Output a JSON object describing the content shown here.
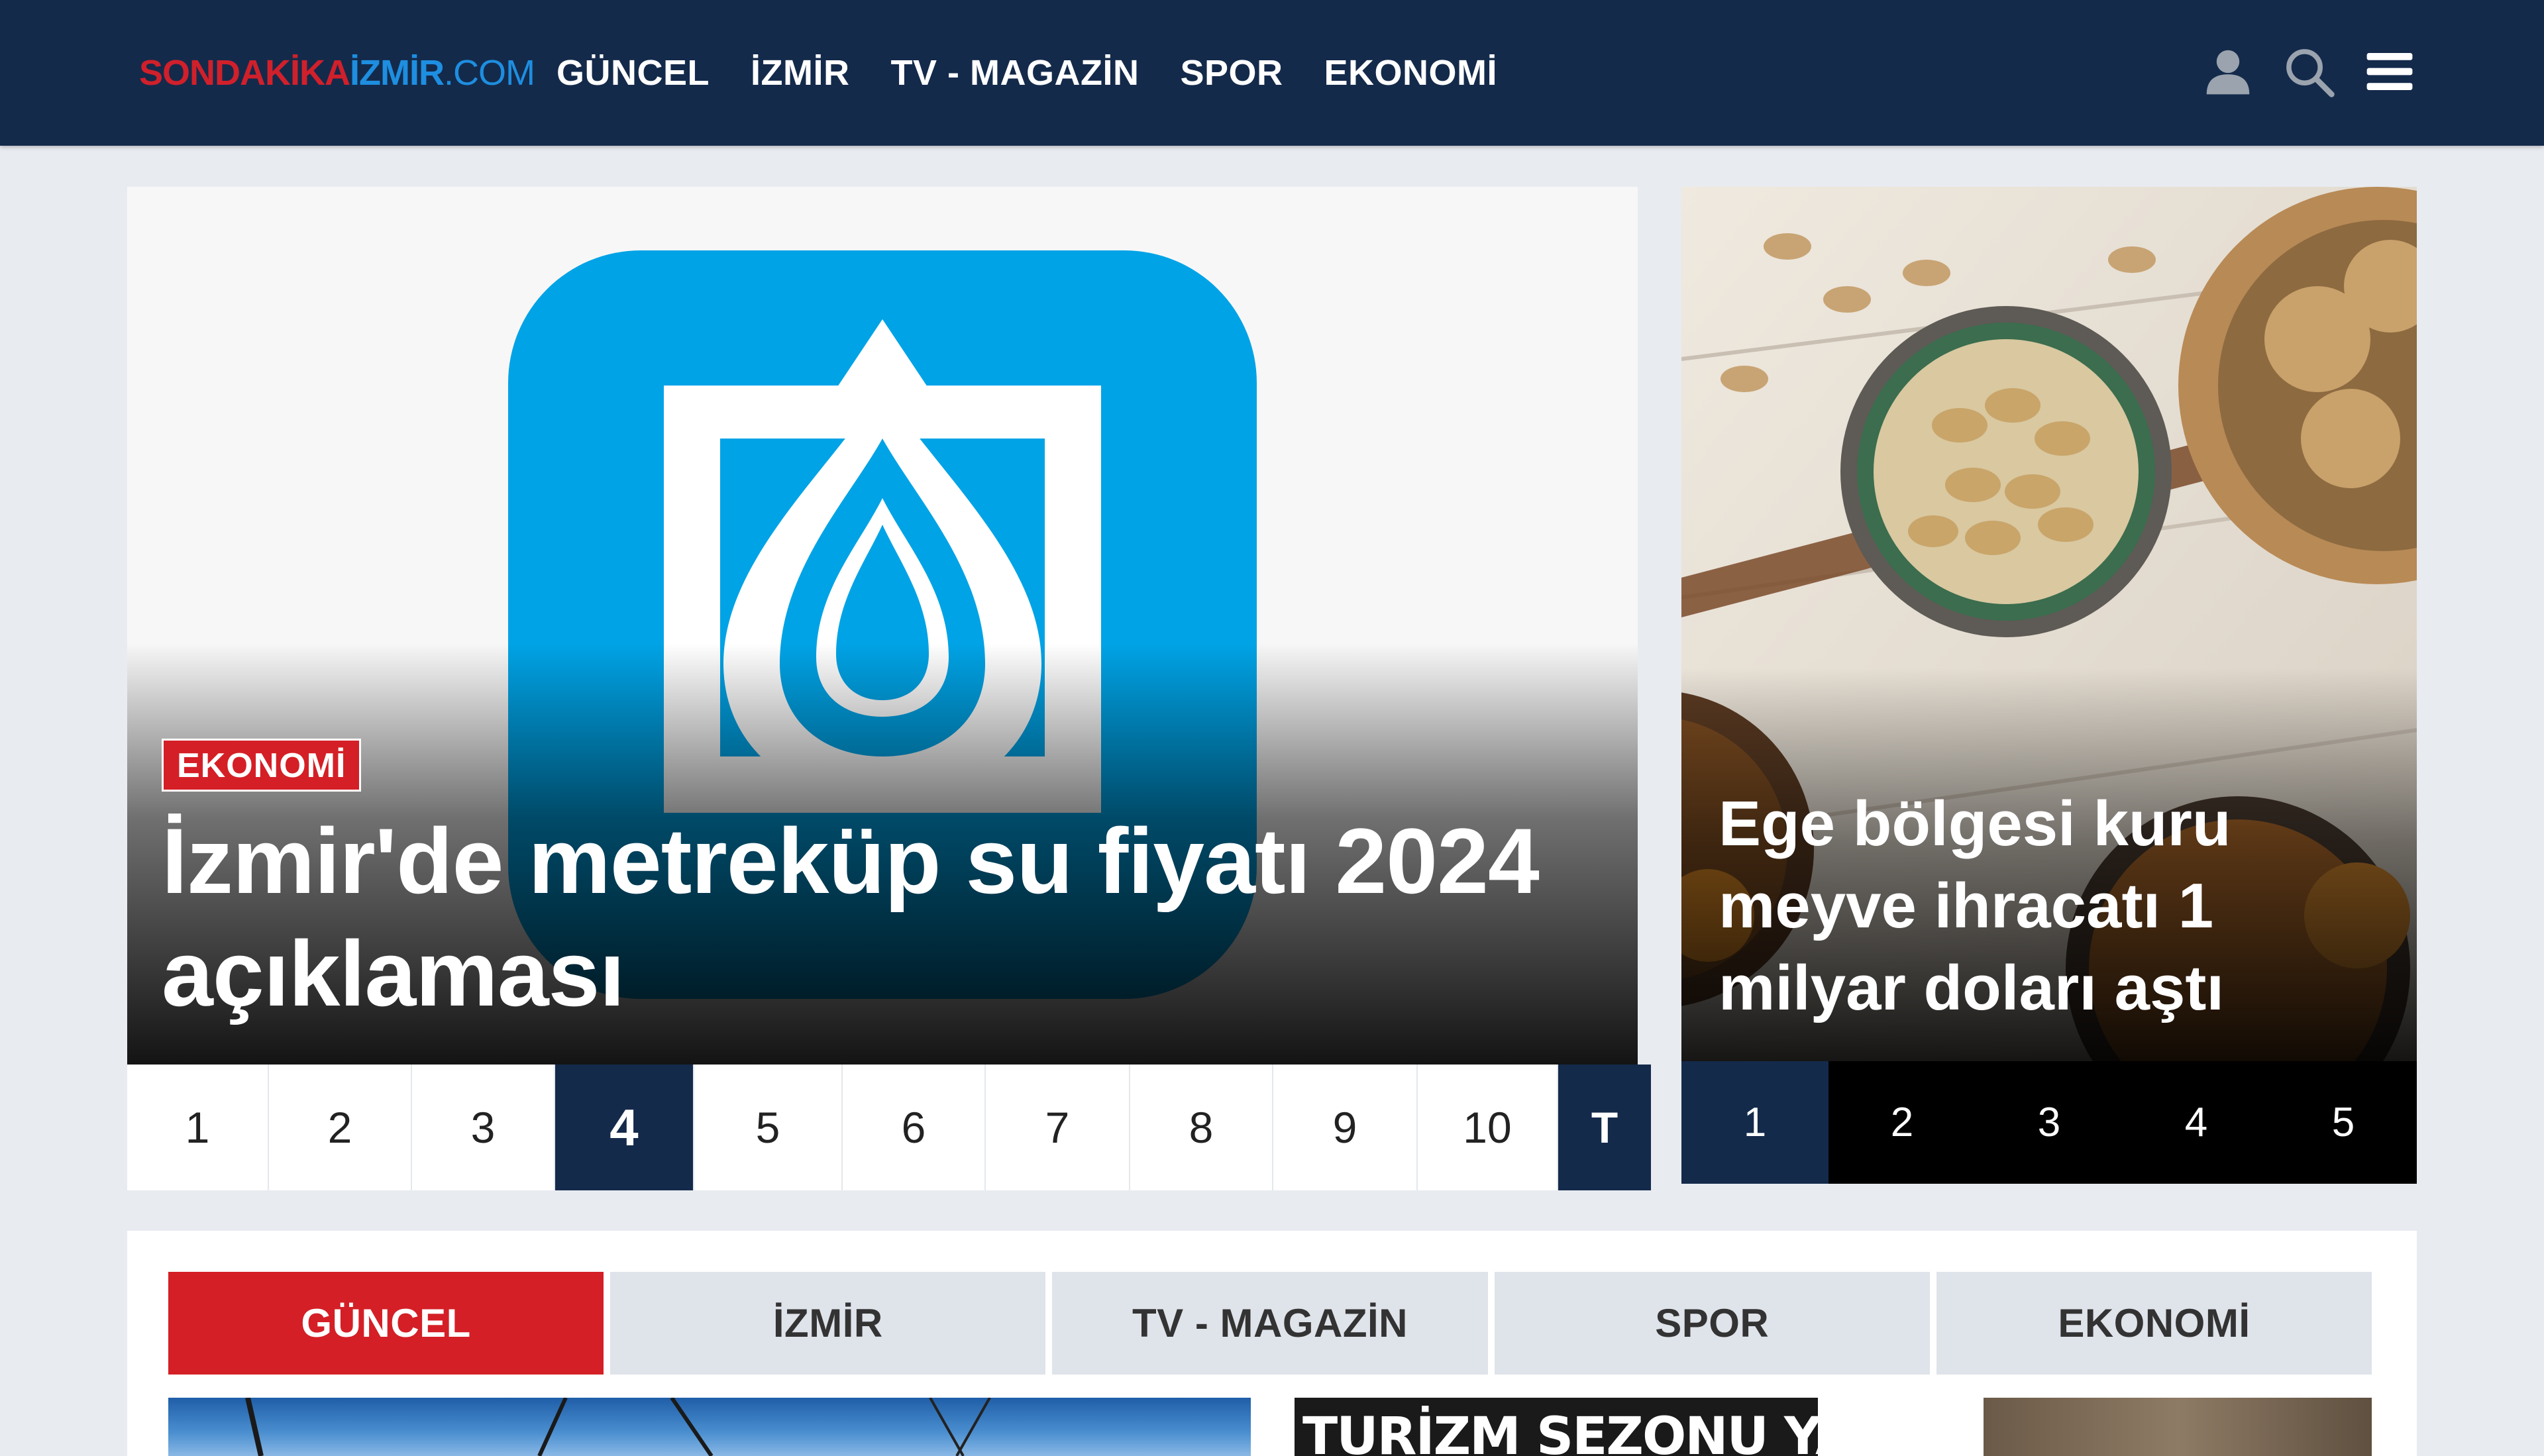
{
  "header": {
    "logo": {
      "part1": "SONDAKİKA",
      "part2": "İZMİR",
      "part3": ".COM"
    },
    "nav": [
      "GÜNCEL",
      "İZMİR",
      "TV - MAGAZİN",
      "SPOR",
      "EKONOMİ"
    ],
    "icons": [
      "user-icon",
      "search-icon",
      "menu-icon"
    ]
  },
  "main_slider": {
    "category": "EKONOMİ",
    "title": "İzmir'de metreküp su fiyatı 2024 açıklaması",
    "pager": [
      "1",
      "2",
      "3",
      "4",
      "5",
      "6",
      "7",
      "8",
      "9",
      "10",
      "T"
    ],
    "active_page": "4",
    "image_icon": "water-drop-app-icon"
  },
  "side_slider": {
    "title": "Ege bölgesi kuru meyve ihracatı 1 milyar doları aştı",
    "pager": [
      "1",
      "2",
      "3",
      "4",
      "5"
    ],
    "active_page": "1"
  },
  "category_tabs": {
    "tabs": [
      "GÜNCEL",
      "İZMİR",
      "TV - MAGAZİN",
      "SPOR",
      "EKONOMİ"
    ],
    "active": "GÜNCEL",
    "thumb_text": "TURİZM SEZONU YAKLAŞIYOR"
  },
  "colors": {
    "navy": "#142a4b",
    "red": "#d41f26",
    "logo_blue": "#1e8ee0",
    "app_icon_blue": "#00a3e6"
  }
}
